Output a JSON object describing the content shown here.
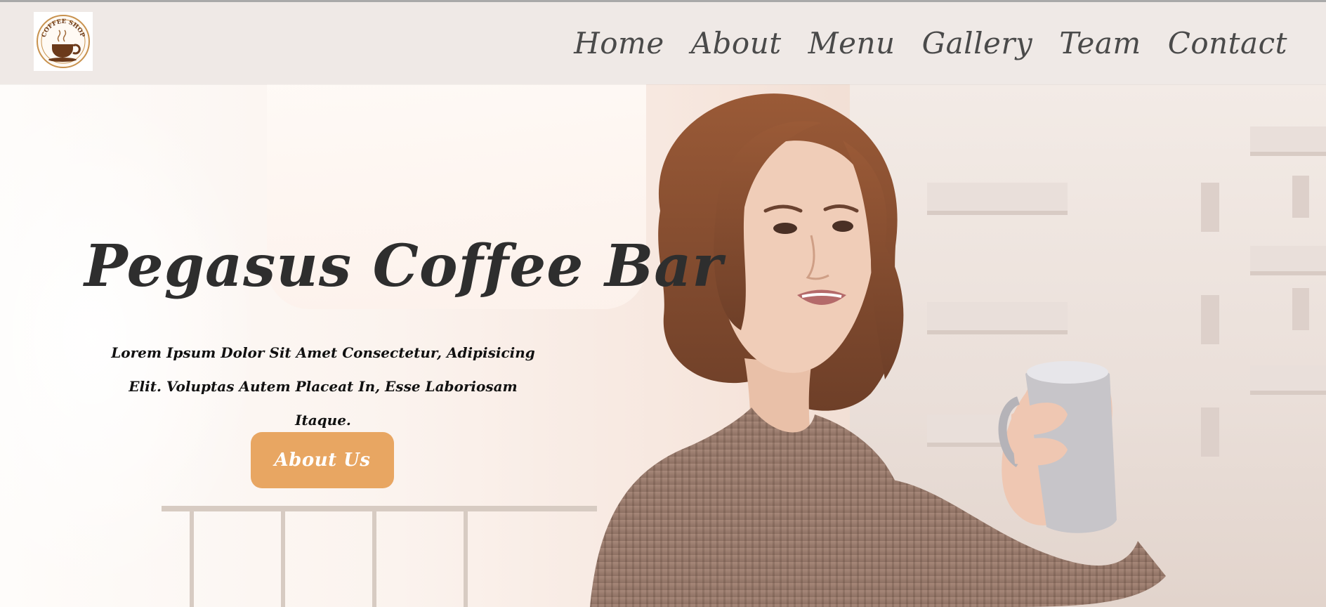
{
  "logo": {
    "text": "COFFEE SHOP",
    "icon": "coffee-cup-icon"
  },
  "nav": {
    "items": [
      {
        "label": "Home"
      },
      {
        "label": "About"
      },
      {
        "label": "Menu"
      },
      {
        "label": "Gallery"
      },
      {
        "label": "Team"
      },
      {
        "label": "Contact"
      }
    ]
  },
  "hero": {
    "title": "Pegasus Coffee Bar",
    "description": "Lorem Ipsum Dolor Sit Amet Consectetur, Adipisicing Elit. Voluptas Autem Placeat In, Esse Laboriosam Itaque.",
    "button_label": "About Us"
  },
  "colors": {
    "header_bg": "#efe9e6",
    "nav_text": "#4a4a4a",
    "accent": "#e8a662",
    "title_text": "#2e2e2e"
  }
}
